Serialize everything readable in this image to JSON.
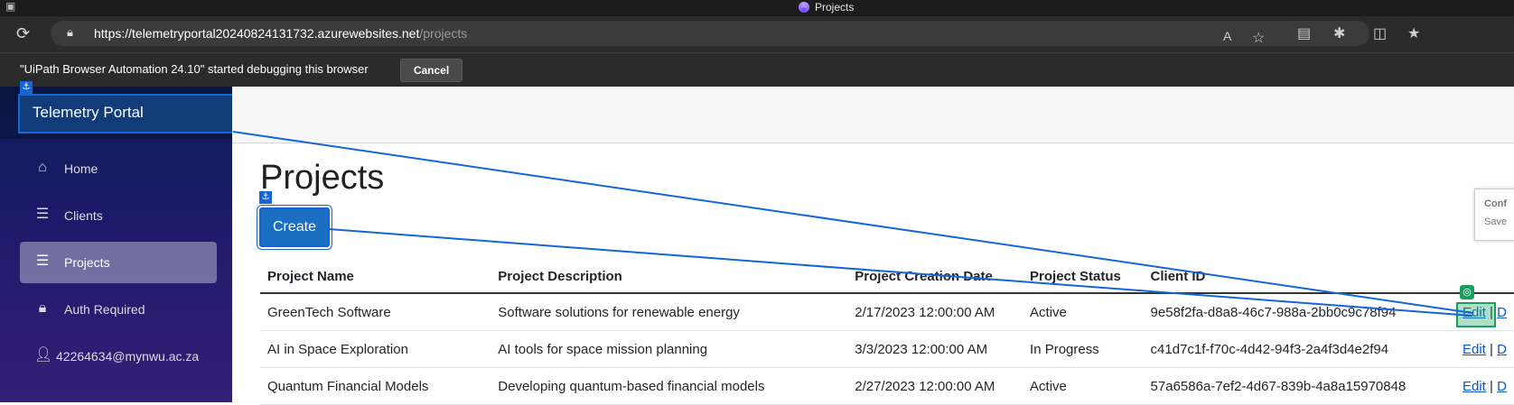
{
  "window": {
    "tab_title": "Projects"
  },
  "browser": {
    "url_host": "https://telemetryportal20240824131732.azurewebsites.net",
    "url_path": "/projects"
  },
  "debug_bar": {
    "message": "\"UiPath Browser Automation 24.10\" started debugging this browser",
    "cancel_label": "Cancel"
  },
  "sidebar": {
    "brand": "Telemetry Portal",
    "items": [
      {
        "label": "Home",
        "icon": "home-icon",
        "active": false
      },
      {
        "label": "Clients",
        "icon": "list-icon",
        "active": false
      },
      {
        "label": "Projects",
        "icon": "list-icon",
        "active": true
      },
      {
        "label": "Auth Required",
        "icon": "lock-icon",
        "active": false
      },
      {
        "label": "42264634@mynwu.ac.za",
        "icon": "user-icon",
        "active": false
      }
    ]
  },
  "main": {
    "title": "Projects",
    "create_label": "Create",
    "table": {
      "headers": [
        "Project Name",
        "Project Description",
        "Project Creation Date",
        "Project Status",
        "Client ID"
      ],
      "rows": [
        [
          "GreenTech Software",
          "Software solutions for renewable energy",
          "2/17/2023 12:00:00 AM",
          "Active",
          "9e58f2fa-d8a8-46c7-988a-2bb0c9c78f94"
        ],
        [
          "AI in Space Exploration",
          "AI tools for space mission planning",
          "3/3/2023 12:00:00 AM",
          "In Progress",
          "c41d7c1f-f70c-4d42-94f3-2a4f3d4e2f94"
        ],
        [
          "Quantum Financial Models",
          "Developing quantum-based financial models",
          "2/27/2023 12:00:00 AM",
          "Active",
          "57a6586a-7ef2-4d67-839b-4a8a15970848"
        ]
      ],
      "edit_label": "Edit",
      "separator": "|",
      "delete_label_visible": "D"
    }
  },
  "side_dialog": {
    "line1": "Conf",
    "line2": "Save"
  },
  "colors": {
    "accent": "#1565d8",
    "target": "#17a05d"
  }
}
